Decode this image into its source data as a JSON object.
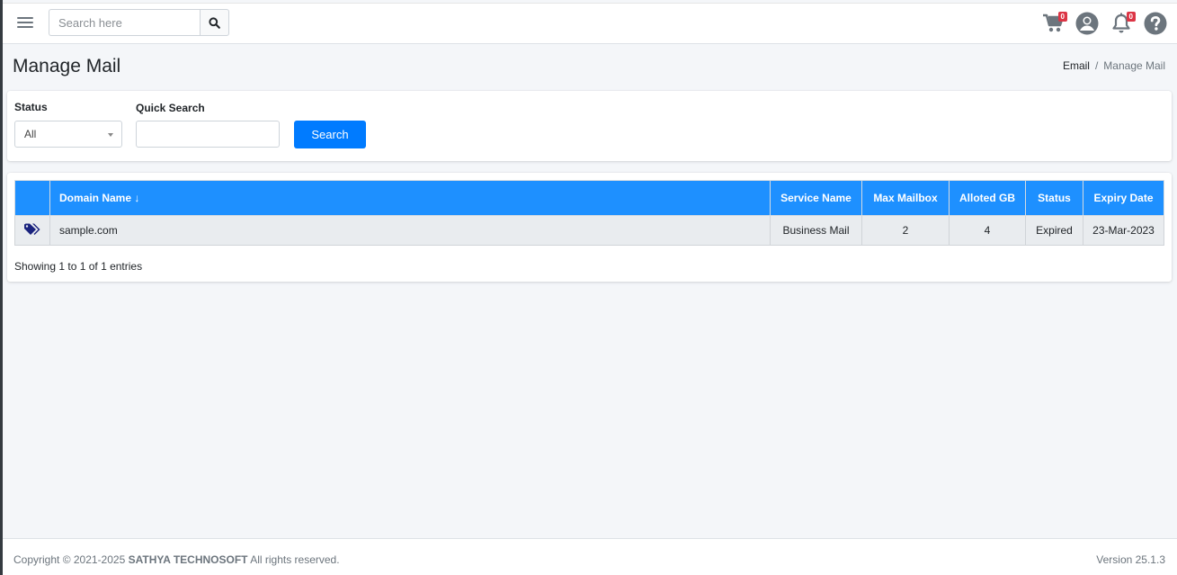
{
  "header": {
    "search_placeholder": "Search here",
    "cart_badge": "0",
    "bell_badge": "0"
  },
  "page": {
    "title": "Manage Mail",
    "breadcrumb": [
      "Email",
      "Manage Mail"
    ]
  },
  "filters": {
    "status_label": "Status",
    "status_value": "All",
    "quick_search_label": "Quick Search",
    "quick_search_value": "",
    "search_button": "Search"
  },
  "table": {
    "columns": [
      "",
      "Domain Name",
      "Service Name",
      "Max Mailbox",
      "Alloted GB",
      "Status",
      "Expiry Date"
    ],
    "sort_indicator": "↓",
    "rows": [
      {
        "icon": "tags-icon",
        "domain": "sample.com",
        "service": "Business Mail",
        "max_mailbox": "2",
        "alloted_gb": "4",
        "status": "Expired",
        "expiry": "23-Mar-2023"
      }
    ],
    "info": "Showing 1 to 1 of 1 entries"
  },
  "footer": {
    "copyright_prefix": "Copyright © 2021-2025",
    "company": "SATHYA TECHNOSOFT",
    "copyright_suffix": "All rights reserved.",
    "version": "Version 25.1.3"
  },
  "colors": {
    "primary": "#007bff",
    "table_header": "#1e90ff",
    "badge": "#dc3545",
    "tag_icon": "#1a237e"
  }
}
